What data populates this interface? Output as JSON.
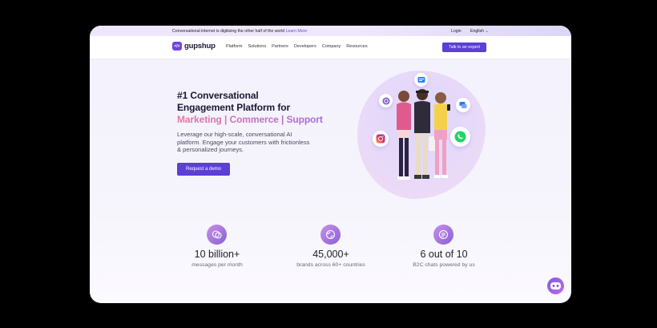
{
  "announcement": {
    "message": "Conversational internet is digitizing the other half of the world",
    "link": "Learn More",
    "login": "Login",
    "language": "English"
  },
  "nav": {
    "logo_text": "gupshup",
    "logo_mark": "</>",
    "menu": [
      "Platform",
      "Solutions",
      "Partners",
      "Developers",
      "Company",
      "Resources"
    ],
    "cta": "Talk to an expert"
  },
  "hero": {
    "title_line1": "#1 Conversational",
    "title_line2": "Engagement Platform for",
    "title_line3": "Marketing | Commerce | Support",
    "subtitle": "Leverage our high-scale, conversational AI platform. Engage your customers with frictionless & personalized journeys.",
    "button": "Request a demo"
  },
  "illustration_icons": [
    "messages-icon",
    "viber-icon",
    "chat-icon",
    "instagram-icon",
    "whatsapp-icon"
  ],
  "stats": [
    {
      "icon": "chat-bubbles-icon",
      "value": "10 billion+",
      "label": "messages per month"
    },
    {
      "icon": "globe-icon",
      "value": "45,000+",
      "label": "brands across 60+ countries"
    },
    {
      "icon": "document-icon",
      "value": "6 out of 10",
      "label": "B2C chats powered by us"
    }
  ],
  "colors": {
    "accent": "#5b3fd6",
    "pink": "#e76f9a",
    "purple": "#a46ad9",
    "background": "#000000"
  }
}
